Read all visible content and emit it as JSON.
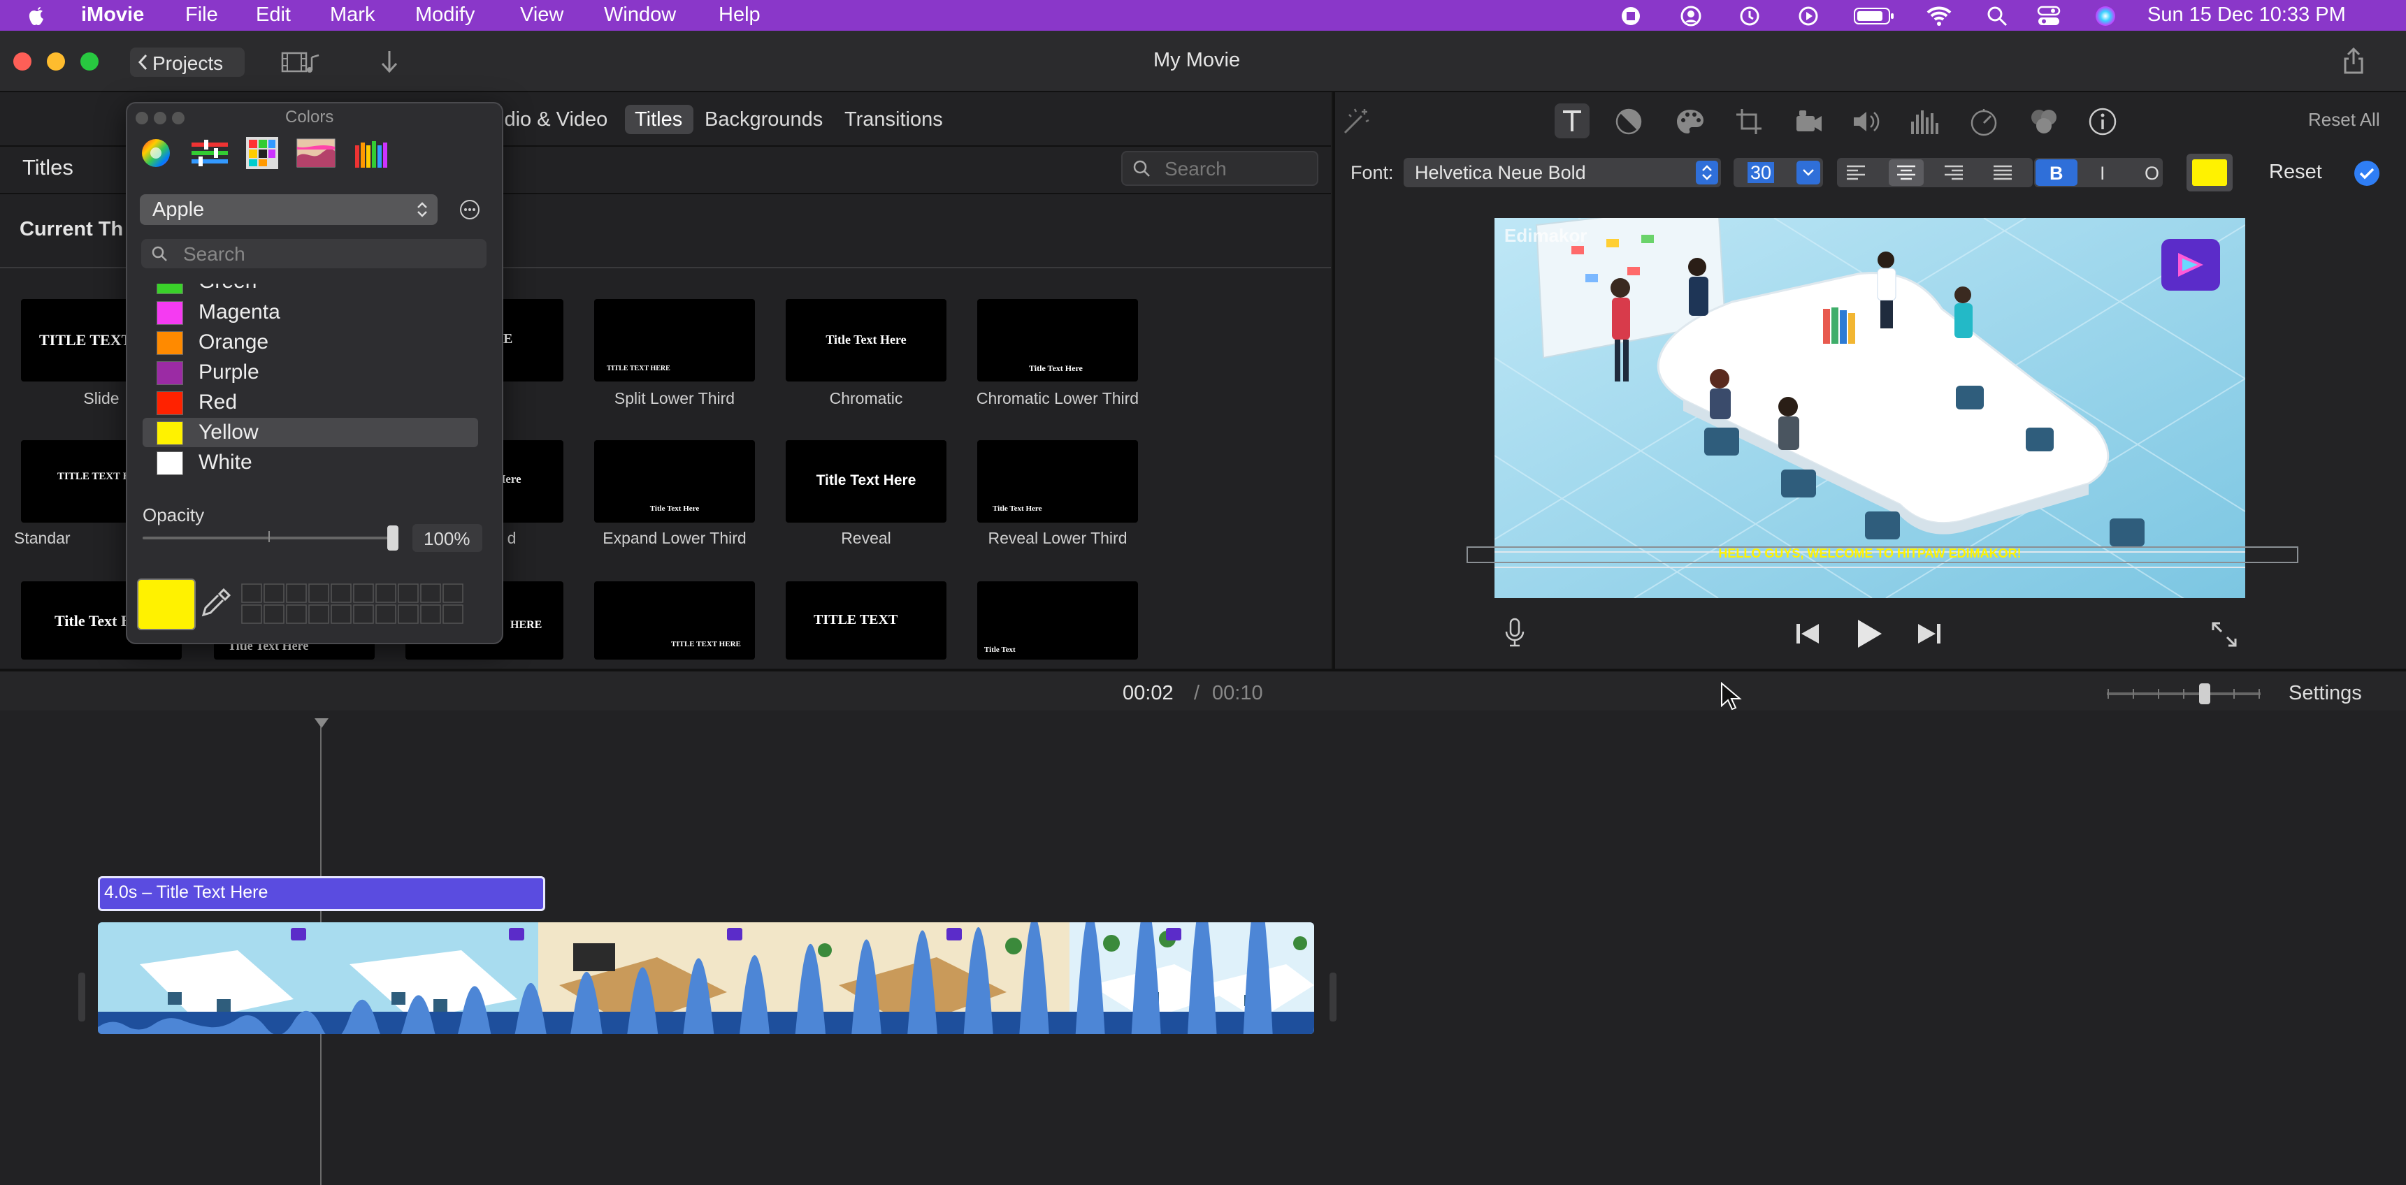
{
  "menubar": {
    "app_name": "iMovie",
    "items": [
      "File",
      "Edit",
      "Mark",
      "Modify",
      "View",
      "Window",
      "Help"
    ],
    "clock": "Sun 15 Dec  10:33 PM"
  },
  "window": {
    "back_label": "Projects",
    "title": "My Movie"
  },
  "browser": {
    "tabs": [
      "Audio & Video",
      "Titles",
      "Backgrounds",
      "Transitions"
    ],
    "selected_tab": "Titles",
    "header": "Titles",
    "section": "Current Th",
    "search_placeholder": "Search",
    "tiles": [
      {
        "label": "Slide",
        "text": "TITLE TEXT"
      },
      {
        "label": "Split Lower Third",
        "text": "TITLE TEXT HERE"
      },
      {
        "label": "Chromatic",
        "text": "Title Text Here"
      },
      {
        "label": "Chromatic Lower Third",
        "text": "Title Text Here"
      },
      {
        "label": "Standar",
        "text": "TITLE TEXT HERE"
      },
      {
        "label": "d",
        "text": "Here"
      },
      {
        "label": "Expand Lower Third",
        "text": "Title Text Here"
      },
      {
        "label": "Reveal",
        "text": "Title Text Here"
      },
      {
        "label": "Reveal Lower Third",
        "text": "Title Text Here"
      },
      {
        "text": "Title Text H"
      },
      {
        "text": "Title Text Here"
      },
      {
        "text": "HERE"
      },
      {
        "text": "TITLE TEXT HERE"
      },
      {
        "text": "TITLE TEXT"
      },
      {
        "text": "Title Text"
      }
    ]
  },
  "colors_panel": {
    "title": "Colors",
    "palette": "Apple",
    "search_placeholder": "Search",
    "colors": [
      {
        "name": "Green",
        "hex": "#3ad12a"
      },
      {
        "name": "Magenta",
        "hex": "#f53bf2"
      },
      {
        "name": "Orange",
        "hex": "#ff8a00"
      },
      {
        "name": "Purple",
        "hex": "#9b2ba4"
      },
      {
        "name": "Red",
        "hex": "#ff2200"
      },
      {
        "name": "Yellow",
        "hex": "#fff200"
      },
      {
        "name": "White",
        "hex": "#ffffff"
      }
    ],
    "selected_color": "Yellow",
    "opacity_label": "Opacity",
    "opacity_value": "100%",
    "opacity_fraction": 1.0,
    "current_swatch": "#fff200"
  },
  "inspector": {
    "reset_all": "Reset All",
    "font_label": "Font:",
    "font_name": "Helvetica Neue Bold",
    "font_size": "30",
    "bold": "B",
    "italic": "I",
    "outline": "O",
    "reset": "Reset",
    "text_color": "#fff200"
  },
  "viewer": {
    "caption": "HELLO GUYS, WELCOME TO HITPAW EDIMAKOR!",
    "watermark": "Edimakor"
  },
  "timeline": {
    "current_time": "00:02",
    "separator": "/",
    "total_time": "00:10",
    "settings": "Settings",
    "title_clip": "4.0s – Title Text Here"
  }
}
